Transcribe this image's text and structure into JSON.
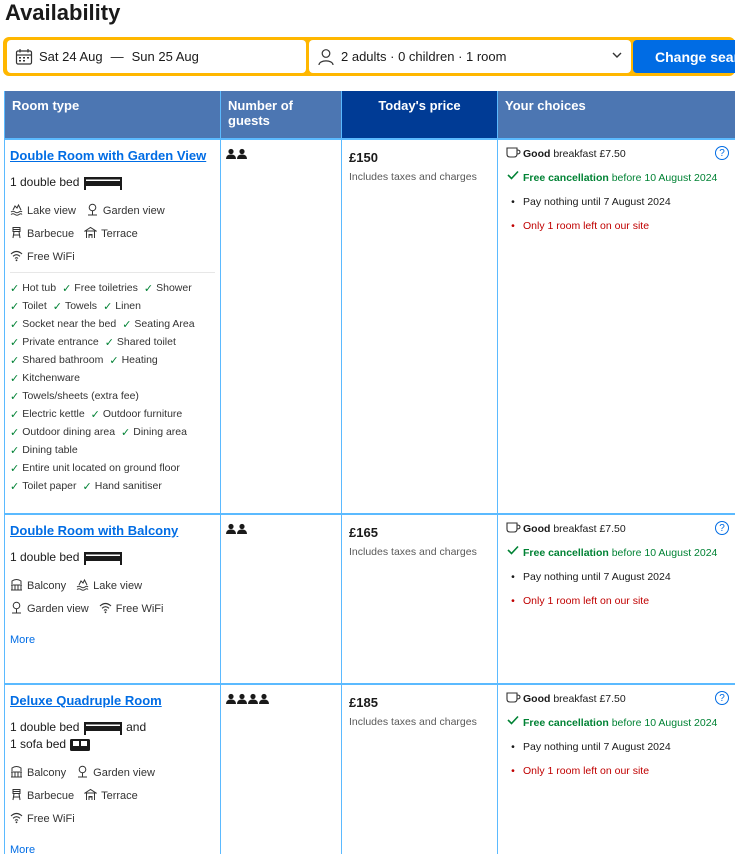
{
  "page_title": "Availability",
  "search": {
    "dates": {
      "checkin": "Sat 24 Aug",
      "separator": "—",
      "checkout": "Sun 25 Aug"
    },
    "guests": "2 adults · 0 children · 1 room",
    "change_button": "Change search"
  },
  "table": {
    "headers": [
      "Room type",
      "Number of guests",
      "Today's price",
      "Your choices"
    ]
  },
  "rooms": [
    {
      "name": "Double Room with Garden View",
      "bed_text": "1 double bed",
      "bed2_text": "",
      "guests": 2,
      "facilities": [
        {
          "icon": "lake-view-icon",
          "label": "Lake view"
        },
        {
          "icon": "garden-view-icon",
          "label": "Garden view"
        },
        {
          "icon": "barbecue-icon",
          "label": "Barbecue"
        },
        {
          "icon": "terrace-icon",
          "label": "Terrace"
        },
        {
          "icon": "wifi-icon",
          "label": "Free WiFi"
        }
      ],
      "amenities": [
        "Hot tub",
        "Free toiletries",
        "Shower",
        "Toilet",
        "Towels",
        "Linen",
        "Socket near the bed",
        "Seating Area",
        "Private entrance",
        "Shared toilet",
        "Shared bathroom",
        "Heating",
        "Kitchenware",
        "Towels/sheets (extra fee)",
        "Electric kettle",
        "Outdoor furniture",
        "Outdoor dining area",
        "Dining area",
        "Dining table",
        "Entire unit located on ground floor",
        "Toilet paper",
        "Hand sanitiser"
      ],
      "more": "",
      "price": "£150",
      "taxes": "Includes taxes and charges",
      "choices": {
        "breakfast_bold": "Good",
        "breakfast_rest": "breakfast £7.50",
        "cancel_bold": "Free cancellation",
        "cancel_rest": "before 10 August 2024",
        "pay": "Pay nothing until 7 August 2024",
        "left": "Only 1 room left on our site"
      }
    },
    {
      "name": "Double Room with Balcony",
      "bed_text": "1 double bed",
      "bed2_text": "",
      "guests": 2,
      "facilities": [
        {
          "icon": "balcony-icon",
          "label": "Balcony"
        },
        {
          "icon": "lake-view-icon",
          "label": "Lake view"
        },
        {
          "icon": "garden-view-icon",
          "label": "Garden view"
        },
        {
          "icon": "wifi-icon",
          "label": "Free WiFi"
        }
      ],
      "amenities": [],
      "more": "More",
      "price": "£165",
      "taxes": "Includes taxes and charges",
      "choices": {
        "breakfast_bold": "Good",
        "breakfast_rest": "breakfast £7.50",
        "cancel_bold": "Free cancellation",
        "cancel_rest": "before 10 August 2024",
        "pay": "Pay nothing until 7 August 2024",
        "left": "Only 1 room left on our site"
      }
    },
    {
      "name": "Deluxe Quadruple Room",
      "bed_text": "1 double bed",
      "bed_and": "and",
      "bed2_text": "1 sofa bed",
      "guests": 4,
      "facilities": [
        {
          "icon": "balcony-icon",
          "label": "Balcony"
        },
        {
          "icon": "garden-view-icon",
          "label": "Garden view"
        },
        {
          "icon": "barbecue-icon",
          "label": "Barbecue"
        },
        {
          "icon": "terrace-icon",
          "label": "Terrace"
        },
        {
          "icon": "wifi-icon",
          "label": "Free WiFi"
        }
      ],
      "amenities": [],
      "more": "More",
      "price": "£185",
      "taxes": "Includes taxes and charges",
      "choices": {
        "breakfast_bold": "Good",
        "breakfast_rest": "breakfast £7.50",
        "cancel_bold": "Free cancellation",
        "cancel_rest": "before 10 August 2024",
        "pay": "Pay nothing until 7 August 2024",
        "left": "Only 1 room left on our site"
      }
    }
  ]
}
